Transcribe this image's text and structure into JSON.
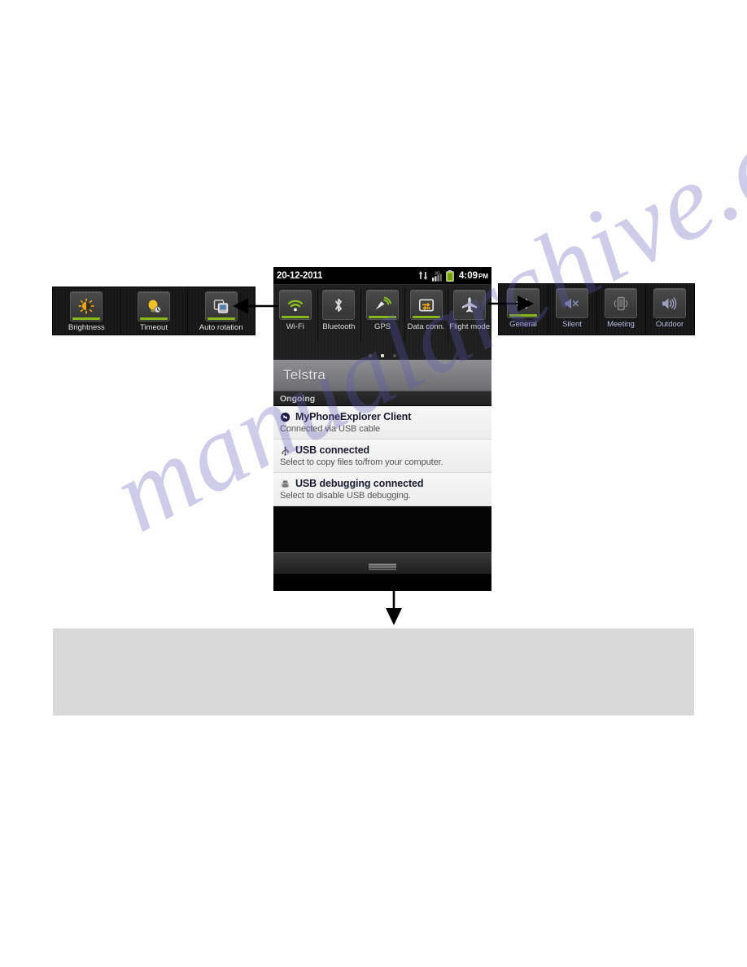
{
  "document": {
    "watermark_text": "manualarchive.com",
    "watermark_color": "#5c56b4"
  },
  "phone": {
    "status_bar": {
      "date": "20-12-2011",
      "time": "4:09",
      "ampm": "PM",
      "icons": [
        "data-transfer-icon",
        "signal-3g-icon",
        "battery-icon"
      ],
      "network_type": "3G"
    },
    "quick_toggles": {
      "items": [
        {
          "label": "Wi-Fi",
          "icon": "wifi-icon",
          "state": "on"
        },
        {
          "label": "Bluetooth",
          "icon": "bluetooth-icon",
          "state": "off"
        },
        {
          "label": "GPS",
          "icon": "gps-icon",
          "state": "on"
        },
        {
          "label": "Data conn.",
          "icon": "data-conn-icon",
          "state": "on"
        },
        {
          "label": "Flight mode",
          "icon": "airplane-icon",
          "state": "off"
        }
      ],
      "pager": {
        "count": 3,
        "active_index": 1
      }
    },
    "carrier": "Telstra",
    "section_header": "Ongoing",
    "notifications": [
      {
        "title": "MyPhoneExplorer Client",
        "description": "Connected via USB cable",
        "icon": "sync-circle-icon"
      },
      {
        "title": "USB connected",
        "description": "Select to copy files to/from your computer.",
        "icon": "usb-icon"
      },
      {
        "title": "USB debugging connected",
        "description": "Select to disable USB debugging.",
        "icon": "android-bug-icon"
      }
    ],
    "drag_handle": "notification-drag-handle"
  },
  "callout_left": {
    "items": [
      {
        "label": "Brightness",
        "icon": "brightness-icon",
        "state": "on"
      },
      {
        "label": "Timeout",
        "icon": "timeout-bulb-icon",
        "state": "on"
      },
      {
        "label": "Auto rotation",
        "icon": "auto-rotation-icon",
        "state": "on"
      }
    ]
  },
  "callout_right": {
    "items": [
      {
        "label": "General",
        "icon": "speaker-on-icon",
        "state": "on"
      },
      {
        "label": "Silent",
        "icon": "speaker-mute-icon",
        "state": "off"
      },
      {
        "label": "Meeting",
        "icon": "vibrate-icon",
        "state": "off"
      },
      {
        "label": "Outdoor",
        "icon": "speaker-loud-icon",
        "state": "off"
      }
    ]
  },
  "annotations": {
    "arrow_left": "arrow-pointing-left",
    "arrow_right": "arrow-pointing-right",
    "arrow_down": "arrow-pointing-down"
  },
  "bottom_panel": {
    "text": ""
  },
  "colors": {
    "accent_green": "#86b81c",
    "panel_background": "#181818",
    "carrier_bar": "#7d7d81",
    "notification_background": "#f3f3f3",
    "gray_box": "#d9d9d9"
  }
}
